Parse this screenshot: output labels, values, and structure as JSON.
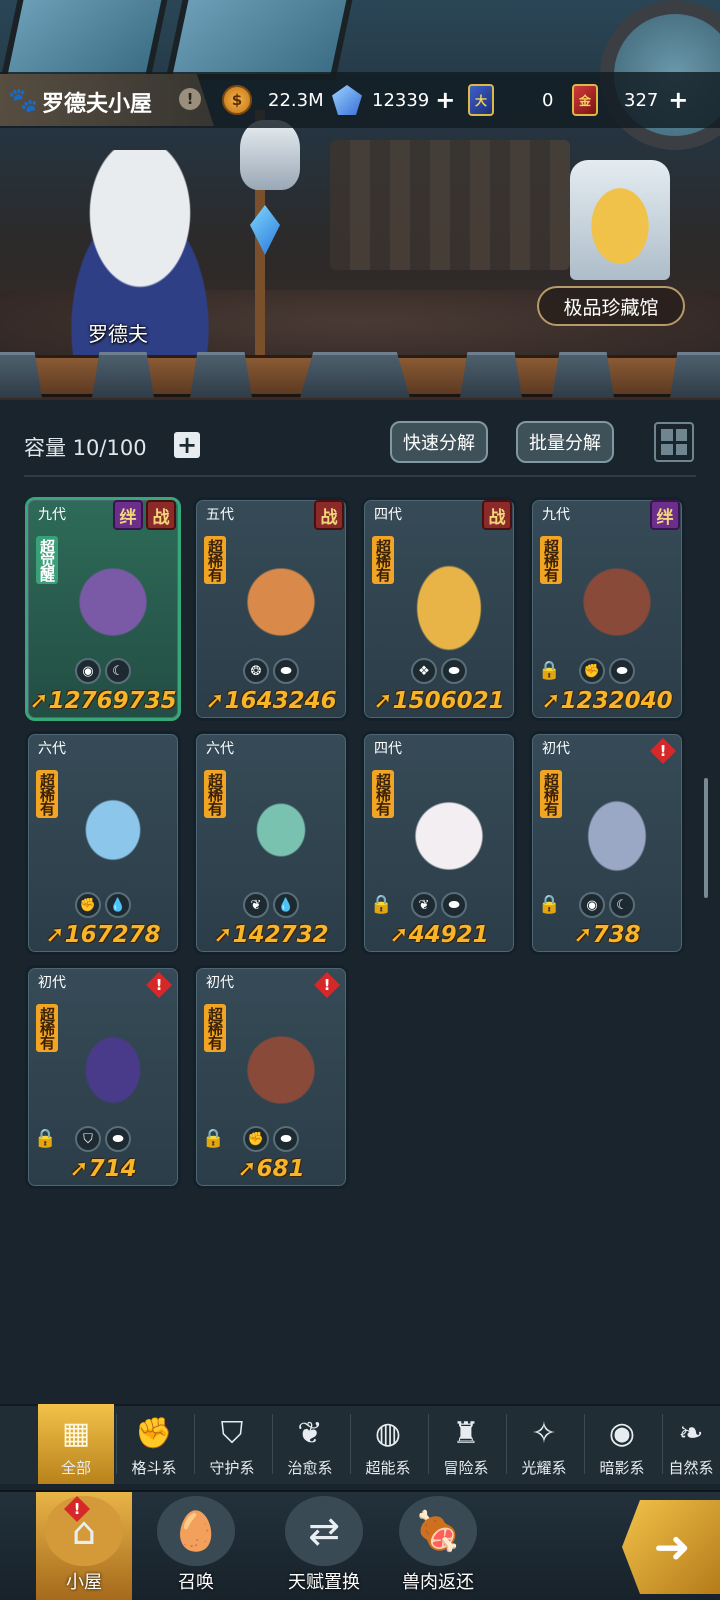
{
  "header": {
    "location_name": "罗德夫小屋",
    "info_mark": "!",
    "resources": [
      {
        "icon": "coin-icon",
        "value": "22.3M"
      },
      {
        "icon": "crystal-icon",
        "value": "12339"
      },
      {
        "icon": "ticket-icon",
        "glyph": "大",
        "value": "0"
      },
      {
        "icon": "gold-ticket-icon",
        "glyph": "金",
        "value": "327"
      }
    ]
  },
  "scene": {
    "character_name": "罗德夫",
    "museum_button": "极品珍藏馆"
  },
  "storage": {
    "capacity_label": "容量 10/100",
    "quick_decompose": "快速分解",
    "batch_decompose": "批量分解"
  },
  "pets": [
    {
      "generation": "九代",
      "rarity": "超觉醒",
      "badges": [
        "绊",
        "战"
      ],
      "power": "12769735",
      "elements": [
        "eye",
        "moon"
      ],
      "locked": false,
      "alert": false
    },
    {
      "generation": "五代",
      "rarity": "超稀有",
      "badges": [
        "战"
      ],
      "power": "1643246",
      "elements": [
        "guard",
        "meat"
      ],
      "locked": false,
      "alert": false
    },
    {
      "generation": "四代",
      "rarity": "超稀有",
      "badges": [
        "战"
      ],
      "power": "1506021",
      "elements": [
        "flame",
        "meat"
      ],
      "locked": false,
      "alert": false
    },
    {
      "generation": "九代",
      "rarity": "超稀有",
      "badges": [
        "绊"
      ],
      "power": "1232040",
      "elements": [
        "fist",
        "meat"
      ],
      "locked": true,
      "alert": false
    },
    {
      "generation": "六代",
      "rarity": "超稀有",
      "badges": [],
      "power": "167278",
      "elements": [
        "fist",
        "water"
      ],
      "locked": false,
      "alert": false
    },
    {
      "generation": "六代",
      "rarity": "超稀有",
      "badges": [],
      "power": "142732",
      "elements": [
        "sprout",
        "water"
      ],
      "locked": false,
      "alert": false
    },
    {
      "generation": "四代",
      "rarity": "超稀有",
      "badges": [],
      "power": "44921",
      "elements": [
        "sprout",
        "meat"
      ],
      "locked": true,
      "alert": false
    },
    {
      "generation": "初代",
      "rarity": "超稀有",
      "badges": [],
      "power": "738",
      "elements": [
        "eye",
        "moon"
      ],
      "locked": true,
      "alert": true
    },
    {
      "generation": "初代",
      "rarity": "超稀有",
      "badges": [],
      "power": "714",
      "elements": [
        "shield",
        "meat"
      ],
      "locked": true,
      "alert": true
    },
    {
      "generation": "初代",
      "rarity": "超稀有",
      "badges": [],
      "power": "681",
      "elements": [
        "fist",
        "meat"
      ],
      "locked": true,
      "alert": true
    }
  ],
  "filters": [
    {
      "label": "全部",
      "icon": "all-icon",
      "active": true
    },
    {
      "label": "格斗系",
      "icon": "fist-icon",
      "active": false
    },
    {
      "label": "守护系",
      "icon": "shield-icon",
      "active": false
    },
    {
      "label": "治愈系",
      "icon": "sprout-icon",
      "active": false
    },
    {
      "label": "超能系",
      "icon": "psychic-icon",
      "active": false
    },
    {
      "label": "冒险系",
      "icon": "lantern-icon",
      "active": false
    },
    {
      "label": "光耀系",
      "icon": "light-icon",
      "active": false
    },
    {
      "label": "暗影系",
      "icon": "eye-icon",
      "active": false
    },
    {
      "label": "自然系",
      "icon": "leaf-icon",
      "active": false
    }
  ],
  "nav": [
    {
      "label": "小屋",
      "icon": "house-icon",
      "active": true,
      "alert": true
    },
    {
      "label": "召唤",
      "icon": "egg-icon",
      "active": false,
      "alert": false
    },
    {
      "label": "天赋置换",
      "icon": "swap-icon",
      "active": false,
      "alert": false
    },
    {
      "label": "兽肉返还",
      "icon": "meat-icon",
      "active": false,
      "alert": false
    }
  ],
  "colors": {
    "accent_gold": "#f2c24a",
    "power_orange": "#f7b62a",
    "rarity_orange": "#f2a424",
    "card_bg": "#364b57",
    "alert_red": "#d62828"
  }
}
